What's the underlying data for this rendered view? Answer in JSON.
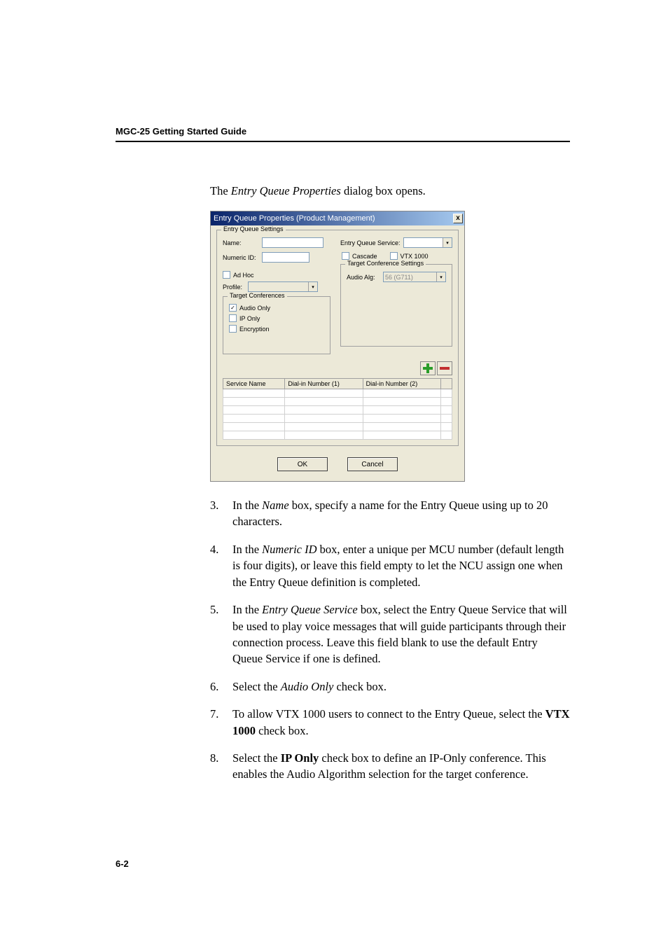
{
  "header": {
    "title": "MGC-25 Getting Started Guide"
  },
  "intro": {
    "pre": "The ",
    "em": "Entry Queue Properties",
    "post": " dialog box opens."
  },
  "dialog": {
    "title": "Entry Queue Properties (Product Management)",
    "close": "x",
    "group_settings_legend": "Entry Queue Settings",
    "name_label": "Name:",
    "numeric_label": "Numeric ID:",
    "adhoc_label": "Ad Hoc",
    "profile_label": "Profile:",
    "target_conf_legend": "Target Conferences",
    "audio_only_label": "Audio Only",
    "ip_only_label": "IP Only",
    "encryption_label": "Encryption",
    "eqs_label": "Entry Queue Service:",
    "cascade_label": "Cascade",
    "vtx_label": "VTX 1000",
    "tcs_legend": "Target Conference Settings",
    "audio_alg_label": "Audio Alg:",
    "audio_alg_value": "56 (G711)",
    "col1": "Service Name",
    "col2": "Dial-in Number (1)",
    "col3": "Dial-in Number (2)",
    "ok": "OK",
    "cancel": "Cancel"
  },
  "steps": [
    {
      "n": "3.",
      "parts": [
        "In the ",
        {
          "i": "Name"
        },
        " box, specify a name for the Entry Queue using up to 20 characters."
      ]
    },
    {
      "n": "4.",
      "parts": [
        "In the ",
        {
          "i": "Numeric ID"
        },
        " box, enter a unique per MCU number (default length is four digits), or leave this field empty to let the NCU assign one when the Entry Queue definition is completed."
      ]
    },
    {
      "n": "5.",
      "parts": [
        "In the ",
        {
          "i": "Entry Queue Service"
        },
        " box, select the Entry Queue Service that will be used to play voice messages that will guide participants through their connection process. Leave this field blank to use the default Entry Queue Service if one is defined."
      ]
    },
    {
      "n": "6.",
      "parts": [
        "Select the ",
        {
          "i": "Audio Only"
        },
        " check box."
      ]
    },
    {
      "n": "7.",
      "parts": [
        "To allow VTX 1000 users to connect to the Entry Queue, select the ",
        {
          "b": "VTX 1000"
        },
        " check box."
      ]
    },
    {
      "n": "8.",
      "parts": [
        "Select the ",
        {
          "b": "IP Only"
        },
        " check box to define an IP-Only conference. This enables the Audio Algorithm selection for the target conference."
      ]
    }
  ],
  "page_number": "6-2"
}
